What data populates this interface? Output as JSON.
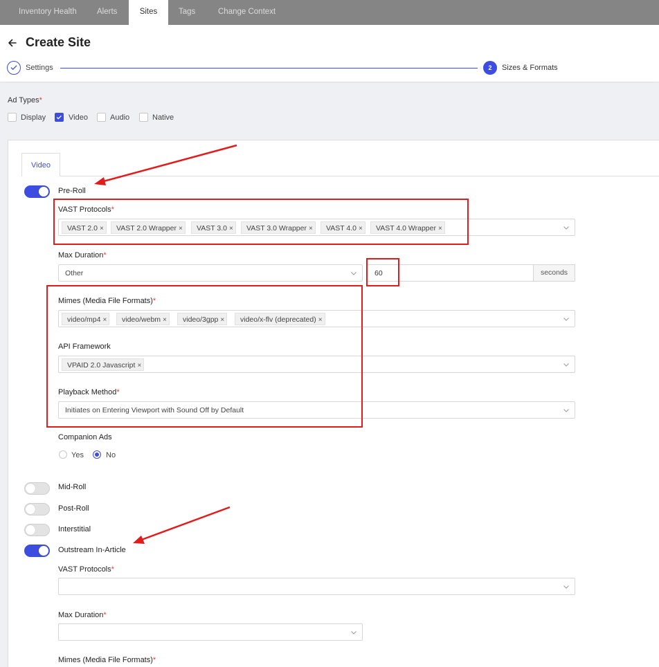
{
  "nav": {
    "tabs": [
      {
        "label": "Inventory Health"
      },
      {
        "label": "Alerts"
      },
      {
        "label": "Sites"
      },
      {
        "label": "Tags"
      },
      {
        "label": "Change Context"
      }
    ],
    "active": "Sites"
  },
  "header": {
    "title": "Create Site",
    "steps": [
      {
        "label": "Settings",
        "status": "complete"
      },
      {
        "number": "2",
        "label": "Sizes & Formats",
        "status": "active"
      }
    ]
  },
  "ad_types": {
    "label": "Ad Types",
    "required_mark": "*",
    "options": [
      {
        "label": "Display",
        "checked": false
      },
      {
        "label": "Video",
        "checked": true
      },
      {
        "label": "Audio",
        "checked": false
      },
      {
        "label": "Native",
        "checked": false
      }
    ]
  },
  "video": {
    "tab_label": "Video",
    "pre_roll": {
      "label": "Pre-Roll",
      "enabled": true,
      "vast_protocols": {
        "label": "VAST Protocols",
        "tags": [
          "VAST 2.0",
          "VAST 2.0 Wrapper",
          "VAST 3.0",
          "VAST 3.0 Wrapper",
          "VAST 4.0",
          "VAST 4.0 Wrapper"
        ]
      },
      "max_duration": {
        "label": "Max Duration",
        "value": "Other",
        "seconds_value": "60",
        "unit": "seconds"
      },
      "mimes": {
        "label": "Mimes (Media File Formats)",
        "tags": [
          "video/mp4",
          "video/webm",
          "video/3gpp",
          "video/x-flv (deprecated)"
        ]
      },
      "api_framework": {
        "label": "API Framework",
        "tags": [
          "VPAID 2.0 Javascript"
        ]
      },
      "playback_method": {
        "label": "Playback Method",
        "value": "Initiates on Entering Viewport with Sound Off by Default"
      },
      "companion_ads": {
        "label": "Companion Ads",
        "options": [
          {
            "label": "Yes",
            "selected": false
          },
          {
            "label": "No",
            "selected": true
          }
        ]
      }
    },
    "mid_roll": {
      "label": "Mid-Roll",
      "enabled": false
    },
    "post_roll": {
      "label": "Post-Roll",
      "enabled": false
    },
    "interstitial": {
      "label": "Interstitial",
      "enabled": false
    },
    "outstream": {
      "label": "Outstream In-Article",
      "enabled": true,
      "vast_protocols_label": "VAST Protocols",
      "max_duration_label": "Max Duration",
      "mimes_label": "Mimes (Media File Formats)"
    }
  },
  "colors": {
    "accent": "#3c4de0",
    "annotation": "#e31b1b",
    "required": "#e53935"
  },
  "icons": {
    "tag_remove": "×"
  }
}
